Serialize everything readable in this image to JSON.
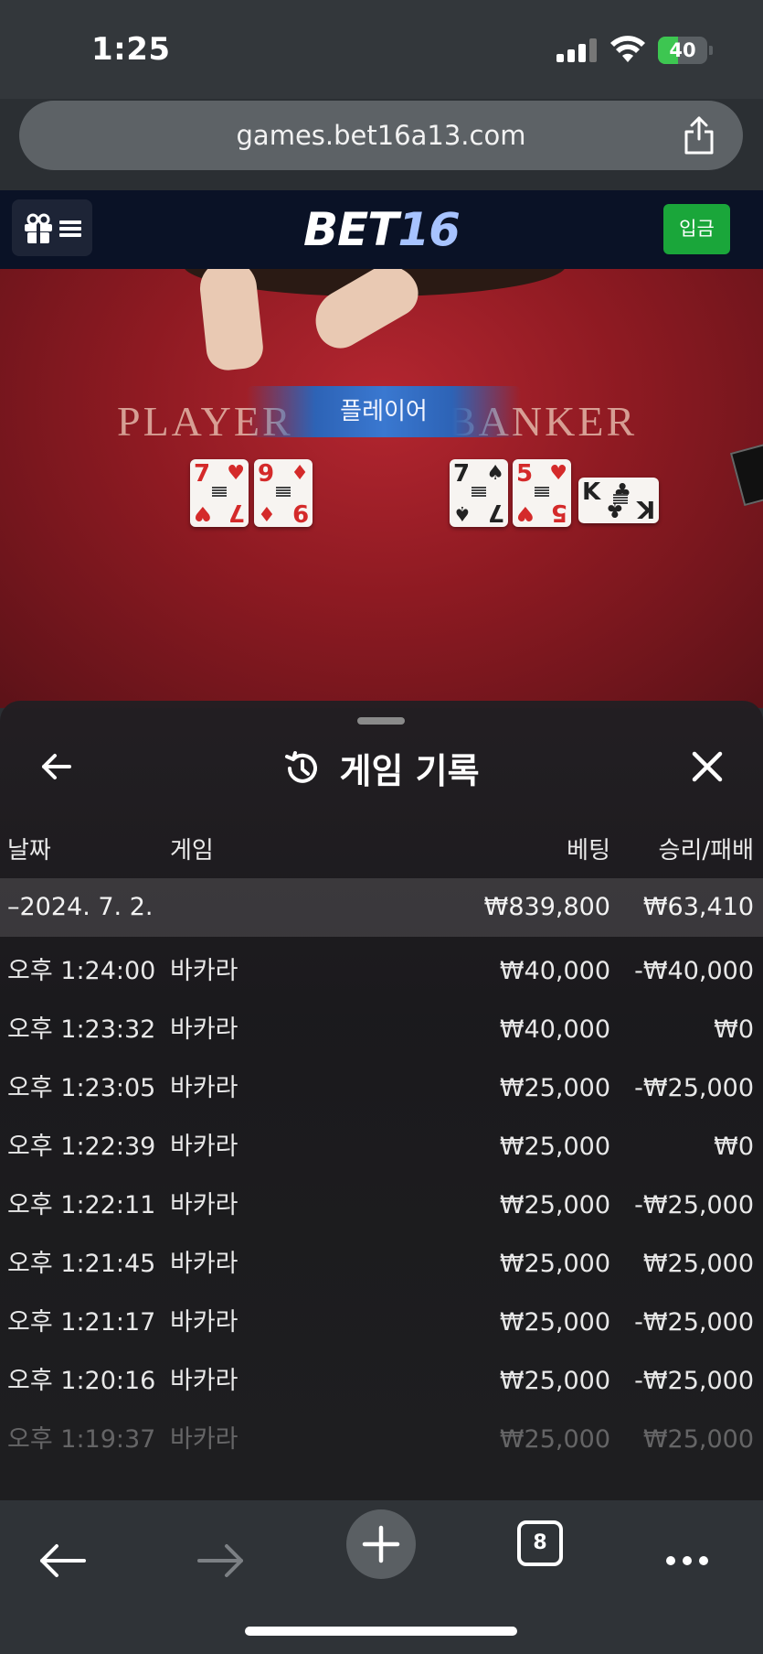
{
  "status_bar": {
    "time": "1:25",
    "battery": "40",
    "battery_level_pct": 40
  },
  "browser": {
    "url": "games.bet16a13.com",
    "tab_count": "8"
  },
  "site": {
    "logo_part1": "BET",
    "logo_part2": "16",
    "deposit_label": "입금"
  },
  "game": {
    "player_label": "PLAYER",
    "banker_label": "BANKER",
    "banner_label": "플레이어",
    "player_cards": [
      {
        "rank": "7",
        "suit": "♥"
      },
      {
        "rank": "9",
        "suit": "♦"
      }
    ],
    "banker_cards": [
      {
        "rank": "7",
        "suit": "♠"
      },
      {
        "rank": "5",
        "suit": "♥"
      },
      {
        "rank": "K",
        "suit": "♣"
      }
    ]
  },
  "history": {
    "title": "게임 기록",
    "columns": {
      "date": "날짜",
      "game": "게임",
      "bet": "베팅",
      "result": "승리/패배"
    },
    "summary": {
      "date": "–2024. 7. 2.",
      "bet": "₩839,800",
      "result": "₩63,410"
    },
    "rows": [
      {
        "time": "오후 1:24:00",
        "game": "바카라",
        "bet": "₩40,000",
        "result": "-₩40,000"
      },
      {
        "time": "오후 1:23:32",
        "game": "바카라",
        "bet": "₩40,000",
        "result": "₩0"
      },
      {
        "time": "오후 1:23:05",
        "game": "바카라",
        "bet": "₩25,000",
        "result": "-₩25,000"
      },
      {
        "time": "오후 1:22:39",
        "game": "바카라",
        "bet": "₩25,000",
        "result": "₩0"
      },
      {
        "time": "오후 1:22:11",
        "game": "바카라",
        "bet": "₩25,000",
        "result": "-₩25,000"
      },
      {
        "time": "오후 1:21:45",
        "game": "바카라",
        "bet": "₩25,000",
        "result": "₩25,000"
      },
      {
        "time": "오후 1:21:17",
        "game": "바카라",
        "bet": "₩25,000",
        "result": "-₩25,000"
      },
      {
        "time": "오후 1:20:16",
        "game": "바카라",
        "bet": "₩25,000",
        "result": "-₩25,000"
      },
      {
        "time": "오후 1:19:37",
        "game": "바카라",
        "bet": "₩25,000",
        "result": "₩25,000"
      }
    ]
  },
  "icons": {
    "back": "arrow-left-icon",
    "close": "close-icon",
    "history": "history-icon",
    "share": "share-icon",
    "gift": "gift-icon",
    "menu": "hamburger-icon"
  }
}
